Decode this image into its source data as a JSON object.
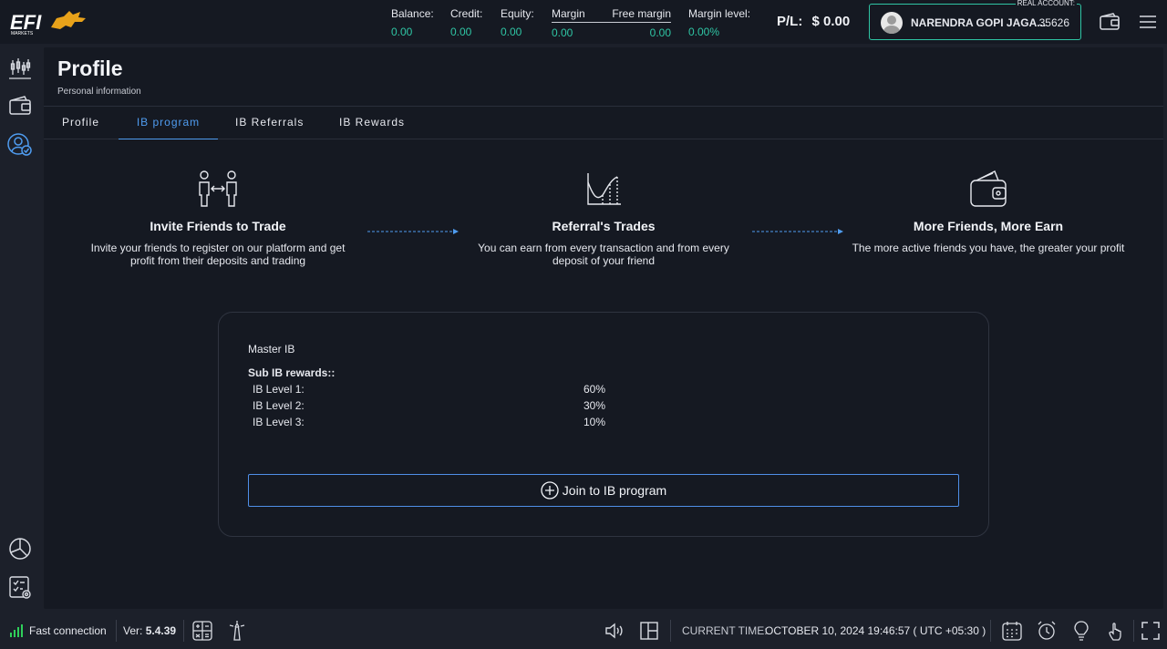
{
  "brand": {
    "logo_text": "EFI",
    "logo_subtext": "MARKETS",
    "accent": "#2fc5a4",
    "link_color": "#4f9cf0",
    "logo_color": "#e8a21a"
  },
  "header": {
    "balance": {
      "label": "Balance:",
      "value": "0.00"
    },
    "credit": {
      "label": "Credit:",
      "value": "0.00"
    },
    "equity": {
      "label": "Equity:",
      "value": "0.00"
    },
    "margin": {
      "label": "Margin",
      "value": "0.00"
    },
    "free_margin": {
      "label": "Free margin",
      "value": "0.00"
    },
    "margin_level": {
      "label": "Margin level:",
      "value": "0.00%"
    },
    "pl": {
      "label": "P/L:",
      "value": "$ 0.00"
    },
    "account": {
      "type_label": "REAL ACCOUNT:",
      "name": "NARENDRA GOPI JAGA...",
      "id": "35626"
    },
    "icons": [
      "wallet-icon",
      "hamburger-menu-icon"
    ]
  },
  "sidebar": {
    "items": [
      {
        "name": "chart-icon"
      },
      {
        "name": "wallet-icon"
      },
      {
        "name": "profile-icon",
        "active": true
      },
      {
        "name": "pie-chart-icon"
      },
      {
        "name": "checklist-settings-icon"
      }
    ]
  },
  "page": {
    "title": "Profile",
    "subtitle": "Personal information"
  },
  "tabs": [
    {
      "label": "Profile",
      "active": false
    },
    {
      "label": "IB program",
      "active": true
    },
    {
      "label": "IB Referrals",
      "active": false
    },
    {
      "label": "IB Rewards",
      "active": false
    }
  ],
  "steps": [
    {
      "icon": "invite-friends-icon",
      "title": "Invite Friends to Trade",
      "text": "Invite your friends to register on our platform and get profit from their deposits and trading"
    },
    {
      "icon": "trades-chart-icon",
      "title": "Referral's Trades",
      "text": "You can earn from every transaction and from every deposit of your friend"
    },
    {
      "icon": "wallet-earn-icon",
      "title": "More Friends, More Earn",
      "text": "The more active friends you have, the greater your profit"
    }
  ],
  "ib_card": {
    "master_label": "Master IB",
    "sub_rewards_label": "Sub IB rewards::",
    "levels": [
      {
        "label": "IB Level 1:",
        "value": "60%"
      },
      {
        "label": "IB Level 2:",
        "value": "30%"
      },
      {
        "label": "IB Level 3:",
        "value": "10%"
      }
    ],
    "join_button": "Join to IB program"
  },
  "statusbar": {
    "connection": "Fast connection",
    "version_label": "Ver:",
    "version": "5.4.39",
    "current_time_label": "CURRENT TIME:",
    "current_time": "OCTOBER 10, 2024 19:46:57 ( UTC +05:30 )"
  }
}
